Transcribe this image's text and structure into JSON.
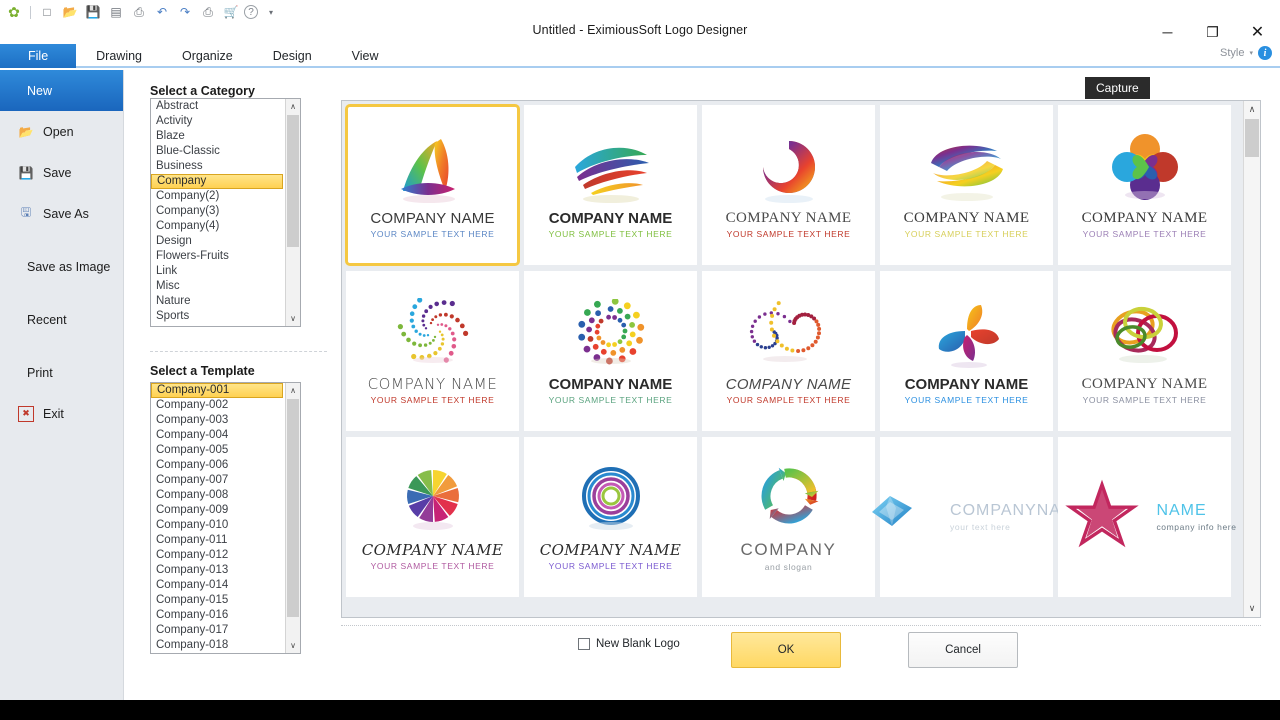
{
  "window": {
    "title": "Untitled - EximiousSoft Logo Designer",
    "controls": {
      "minimize": "─",
      "maximize": "❐",
      "close": "✕"
    }
  },
  "quick_access": {
    "items": [
      {
        "name": "app-logo-icon",
        "glyph": "✿"
      },
      {
        "name": "new-icon",
        "glyph": "□"
      },
      {
        "name": "open-icon",
        "glyph": "📂"
      },
      {
        "name": "save-icon",
        "glyph": "💾"
      },
      {
        "name": "export-icon",
        "glyph": "▤"
      },
      {
        "name": "print-icon",
        "glyph": "⎙"
      },
      {
        "name": "undo-icon",
        "glyph": "↶"
      },
      {
        "name": "redo-icon",
        "glyph": "↷"
      },
      {
        "name": "stamp-icon",
        "glyph": "⎙"
      },
      {
        "name": "cart-icon",
        "glyph": "🛒"
      },
      {
        "name": "help-icon",
        "glyph": "?"
      },
      {
        "name": "customize-caret-icon",
        "glyph": "▾"
      }
    ]
  },
  "ribbon": {
    "tabs": [
      {
        "label": "File",
        "active": true
      },
      {
        "label": "Drawing",
        "active": false
      },
      {
        "label": "Organize",
        "active": false
      },
      {
        "label": "Design",
        "active": false
      },
      {
        "label": "View",
        "active": false
      }
    ],
    "style_label": "Style",
    "style_caret": "▾"
  },
  "backstage": {
    "items": [
      {
        "label": "New",
        "icon": "",
        "active": true,
        "gap": false
      },
      {
        "label": "Open",
        "icon": "📂",
        "active": false,
        "gap": false
      },
      {
        "label": "Save",
        "icon": "💾",
        "active": false,
        "gap": false
      },
      {
        "label": "Save As",
        "icon": "🖫",
        "active": false,
        "gap": false
      },
      {
        "label": "Save as Image",
        "icon": "",
        "active": false,
        "gap": true
      },
      {
        "label": "Recent",
        "icon": "",
        "active": false,
        "gap": true
      },
      {
        "label": "Print",
        "icon": "",
        "active": false,
        "gap": true
      },
      {
        "label": "Exit",
        "icon": "✖",
        "active": false,
        "gap": false
      }
    ]
  },
  "category_panel": {
    "title": "Select a Category",
    "selected": "Company",
    "items": [
      "Abstract",
      "Activity",
      "Blaze",
      "Blue-Classic",
      "Business",
      "Company",
      "Company(2)",
      "Company(3)",
      "Company(4)",
      "Design",
      "Flowers-Fruits",
      "Link",
      "Misc",
      "Nature",
      "Sports"
    ],
    "scroll_up": "∧",
    "scroll_down": "∨"
  },
  "template_panel": {
    "title": "Select a Template",
    "selected": "Company-001",
    "items": [
      "Company-001",
      "Company-002",
      "Company-003",
      "Company-004",
      "Company-005",
      "Company-006",
      "Company-007",
      "Company-008",
      "Company-009",
      "Company-010",
      "Company-011",
      "Company-012",
      "Company-013",
      "Company-014",
      "Company-015",
      "Company-016",
      "Company-017",
      "Company-018"
    ],
    "scroll_up": "∧",
    "scroll_down": "∨"
  },
  "tooltip": {
    "text": "Capture"
  },
  "gallery": {
    "scroll_up": "∧",
    "scroll_down": "∨",
    "thumbnails": [
      {
        "art": "tri-swoosh",
        "name": "COMPANY NAME",
        "sub": "YOUR SAMPLE TEXT HERE",
        "name_color": "#3a3a3a",
        "sub_color": "#5b86c4",
        "name_style": "sans",
        "selected": true
      },
      {
        "art": "ribbon-fan",
        "name": "COMPANY NAME",
        "sub": "YOUR SAMPLE TEXT HERE",
        "name_color": "#2b2b2b",
        "sub_color": "#7fbf3f",
        "name_style": "bold",
        "selected": false
      },
      {
        "art": "swirl-knot",
        "name": "COMPANY NAME",
        "sub": "YOUR SAMPLE TEXT HERE",
        "name_color": "#4a4a4a",
        "sub_color": "#c0392b",
        "name_style": "serif",
        "selected": false
      },
      {
        "art": "oval-swirl",
        "name": "COMPANY NAME",
        "sub": "YOUR SAMPLE TEXT HERE",
        "name_color": "#3a3a3a",
        "sub_color": "#d7cf5a",
        "name_style": "serif",
        "selected": false
      },
      {
        "art": "heart-flower",
        "name": "COMPANY NAME",
        "sub": "YOUR SAMPLE TEXT HERE",
        "name_color": "#3a3a3a",
        "sub_color": "#9b7fb5",
        "name_style": "serif",
        "selected": false
      },
      {
        "art": "dot-spiral-1",
        "name": "COMPANY NAME",
        "sub": "YOUR SAMPLE TEXT HERE",
        "name_color": "#4a4a4a",
        "sub_color": "#c0392b",
        "name_style": "thin",
        "selected": false
      },
      {
        "art": "dot-ring",
        "name": "COMPANY NAME",
        "sub": "YOUR SAMPLE TEXT HERE",
        "name_color": "#2b2b2b",
        "sub_color": "#5aa37f",
        "name_style": "bold",
        "selected": false
      },
      {
        "art": "dot-curl",
        "name": "COMPANY NAME",
        "sub": "YOUR SAMPLE TEXT HERE",
        "name_color": "#4a4a4a",
        "sub_color": "#c0392b",
        "name_style": "italic",
        "selected": false
      },
      {
        "art": "pinwheel-leaf",
        "name": "COMPANY NAME",
        "sub": "YOUR SAMPLE TEXT HERE",
        "name_color": "#2b2b2b",
        "sub_color": "#2a8fe0",
        "name_style": "bold",
        "selected": false
      },
      {
        "art": "three-rings",
        "name": "COMPANY NAME",
        "sub": "YOUR SAMPLE TEXT HERE",
        "name_color": "#4a4a4a",
        "sub_color": "#8a8fa0",
        "name_style": "serif",
        "selected": false
      },
      {
        "art": "color-wheel",
        "name": "COMPANY NAME",
        "sub": "YOUR SAMPLE TEXT HERE",
        "name_color": "#2b2b2b",
        "sub_color": "#b05aa0",
        "name_style": "script",
        "selected": false
      },
      {
        "art": "concentric",
        "name": "COMPANY NAME",
        "sub": "YOUR SAMPLE TEXT HERE",
        "name_color": "#2b2b2b",
        "sub_color": "#7a5ad0",
        "name_style": "script",
        "selected": false
      },
      {
        "art": "arrow-cycle",
        "name": "COMPANY",
        "sub": "and slogan",
        "name_color": "#6a6a6a",
        "sub_color": "#9aa0a6",
        "name_style": "wide",
        "selected": false
      },
      {
        "art": "diamond-gem",
        "name": "COMPANYNAME",
        "sub": "your text here",
        "name_color": "#b9c6d4",
        "sub_color": "#c9d2da",
        "name_style": "inline",
        "selected": false
      },
      {
        "art": "star-mark",
        "name": "NAME",
        "sub": "company info here",
        "name_color": "#4fc3e8",
        "sub_color": "#6b7a85",
        "name_style": "inline",
        "selected": false
      }
    ]
  },
  "footer": {
    "checkbox_label": "New Blank Logo",
    "checkbox_checked": false,
    "ok_label": "OK",
    "cancel_label": "Cancel"
  },
  "colors": {
    "accent_blue": "#2f8ada",
    "selection_yellow": "#ffd152",
    "ok_button": "#ffd863",
    "panel_gray": "#e7eaee"
  }
}
